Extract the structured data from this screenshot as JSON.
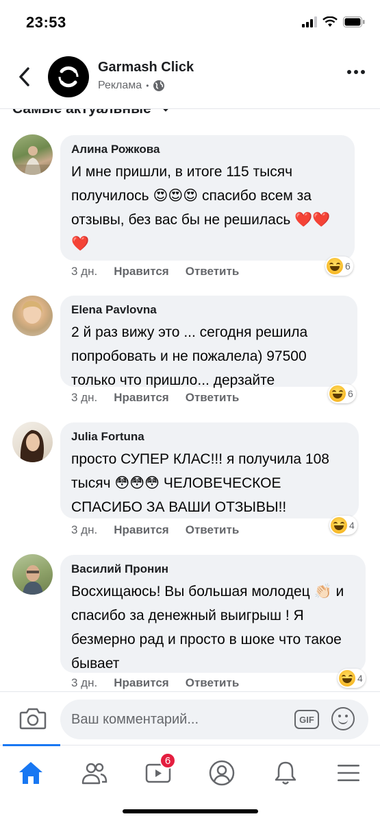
{
  "status_bar": {
    "time": "23:53"
  },
  "header": {
    "page_name": "Garmash Click",
    "subtitle": "Реклама"
  },
  "sort": {
    "label": "Самые актуальные"
  },
  "comments": [
    {
      "author": "Алина Рожкова",
      "text": "И мне пришли, в итоге 115 тысяч получилось 😍😍😍 спасибо всем за отзывы, без вас бы не решилась ❤️❤️❤️",
      "time": "3 дн.",
      "like_label": "Нравится",
      "reply_label": "Ответить",
      "reaction_count": "6"
    },
    {
      "author": "Elena Pavlovna",
      "text": "2 й раз вижу это ... сегодня решила попробовать и не пожалела) 97500 только что пришло... дерзайте",
      "time": "3 дн.",
      "like_label": "Нравится",
      "reply_label": "Ответить",
      "reaction_count": "6"
    },
    {
      "author": "Julia Fortuna",
      "text": "просто СУПЕР КЛАС!!! я получила 108 тысяч 😳😳😳 ЧЕЛОВЕЧЕСКОЕ СПАСИБО ЗА ВАШИ ОТЗЫВЫ!!",
      "time": "3 дн.",
      "like_label": "Нравится",
      "reply_label": "Ответить",
      "reaction_count": "4"
    },
    {
      "author": "Василий Пронин",
      "text": "Восхищаюсь! Вы большая молодец 👏🏻 и спасибо за денежный выигрыш ! Я безмерно рад и просто в шоке что такое бывает",
      "time": "3 дн.",
      "like_label": "Нравится",
      "reply_label": "Ответить",
      "reaction_count": "4"
    }
  ],
  "composer": {
    "placeholder": "Ваш комментарий...",
    "gif_label": "GIF"
  },
  "tab_bar": {
    "watch_badge": "6"
  },
  "colors": {
    "accent": "#1877f2",
    "bubble": "#f0f2f5",
    "badge": "#e41e3f"
  }
}
